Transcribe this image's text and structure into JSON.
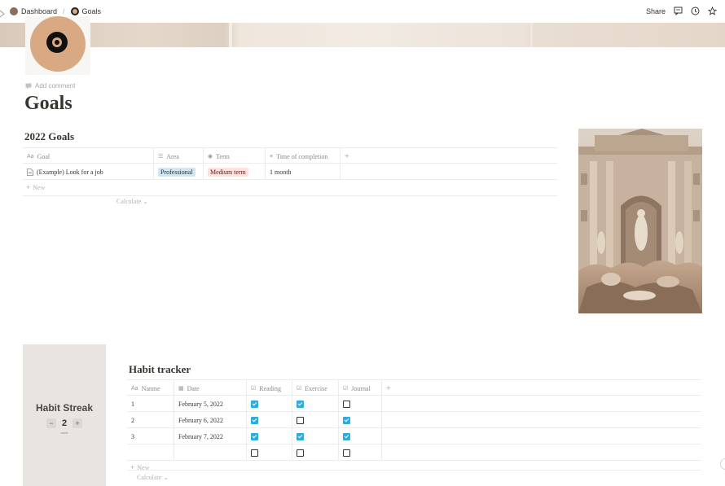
{
  "breadcrumb": {
    "items": [
      {
        "label": "Dashboard",
        "icon": "dashboard-page-icon"
      },
      {
        "label": "Goals",
        "icon": "goals-target-icon"
      }
    ],
    "separator": "/"
  },
  "topbar": {
    "share_label": "Share",
    "icons": [
      "comment-icon",
      "history-icon",
      "favorite-star-icon"
    ]
  },
  "page": {
    "add_comment": "Add comment",
    "title": "Goals"
  },
  "goals_section": {
    "heading": "2022 Goals",
    "columns": [
      {
        "label": "Goal",
        "icon": "Aa"
      },
      {
        "label": "Area",
        "icon": "☰"
      },
      {
        "label": "Term",
        "icon": "◉"
      },
      {
        "label": "Time of completion",
        "icon": "≡"
      }
    ],
    "rows": [
      {
        "goal": "(Example) Look for a job",
        "area": "Professional",
        "term": "Medium term",
        "time": "1 month"
      }
    ],
    "new_label": "New",
    "calculate_label": "Calculate"
  },
  "habit_streak": {
    "title": "Habit Streak",
    "value": "2",
    "decrement": "−",
    "increment": "+",
    "sublabel": "reset"
  },
  "habit_tracker": {
    "heading": "Habit tracker",
    "columns": [
      {
        "label": "Nanme",
        "icon": "Aa"
      },
      {
        "label": "Date",
        "icon": "▦"
      },
      {
        "label": "Reading",
        "icon": "☑"
      },
      {
        "label": "Exercise",
        "icon": "☑"
      },
      {
        "label": "Journal",
        "icon": "☑"
      }
    ],
    "rows": [
      {
        "name": "1",
        "date": "February 5, 2022",
        "reading": true,
        "exercise": true,
        "journal": false
      },
      {
        "name": "2",
        "date": "February 6, 2022",
        "reading": true,
        "exercise": false,
        "journal": true
      },
      {
        "name": "3",
        "date": "February 7, 2022",
        "reading": true,
        "exercise": true,
        "journal": true
      },
      {
        "name": "",
        "date": "",
        "reading": false,
        "exercise": false,
        "journal": false
      }
    ],
    "new_label": "New",
    "calculate_label": "Calculate"
  },
  "colors": {
    "accent_checkbox": "#2eaadc",
    "tag_professional_bg": "#d3e5ef",
    "tag_medium_bg": "#ffe2dd",
    "page_icon_bg": "#d9a983"
  }
}
